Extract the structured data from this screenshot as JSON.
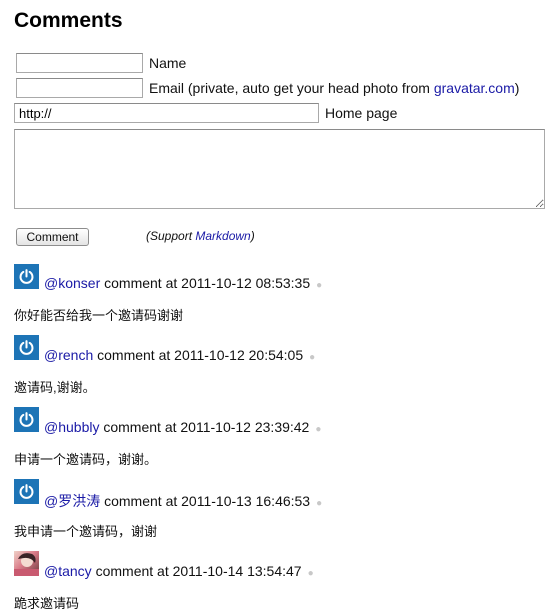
{
  "heading": "Comments",
  "form": {
    "name_label": "Name",
    "email_label_prefix": "Email (private, auto get your head photo from ",
    "email_link": "gravatar.com",
    "email_label_suffix": ")",
    "homepage_value": "http://",
    "homepage_label": "Home page",
    "submit_label": "Comment",
    "support_prefix": "(Support ",
    "support_link": "Markdown",
    "support_suffix": ")"
  },
  "comments": [
    {
      "author": "@konser",
      "meta": "comment at 2011-10-12 08:53:35",
      "text": "你好能否给我一个邀请码谢谢",
      "avatar": "power-icon"
    },
    {
      "author": "@rench",
      "meta": "comment at 2011-10-12 20:54:05",
      "text": "邀请码,谢谢。",
      "avatar": "power-icon"
    },
    {
      "author": "@hubbly",
      "meta": "comment at 2011-10-12 23:39:42",
      "text": "申请一个邀请码，谢谢。",
      "avatar": "power-icon"
    },
    {
      "author": "@罗洪涛",
      "meta": "comment at 2011-10-13 16:46:53",
      "text": "我申请一个邀请码，谢谢",
      "avatar": "power-icon"
    },
    {
      "author": "@tancy",
      "meta": "comment at 2011-10-14 13:54:47",
      "text": "跪求邀请码",
      "avatar": "photo"
    }
  ],
  "colors": {
    "link": "#1a1aa6",
    "avatar_bg": "#1d74b6"
  }
}
